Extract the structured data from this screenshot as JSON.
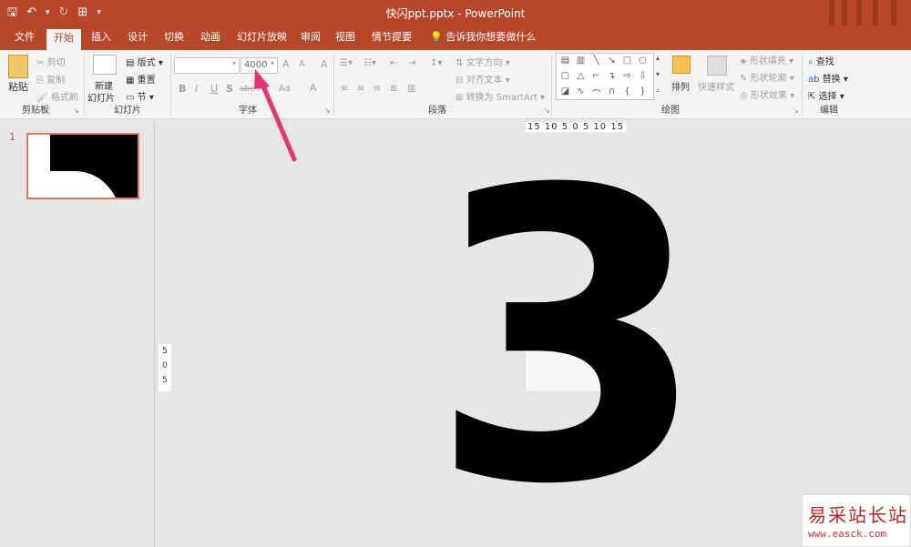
{
  "window": {
    "title": "快闪ppt.pptx  -  PowerPoint"
  },
  "qat": {
    "save": "🖫",
    "undo": "↶",
    "undo_drop": "▾",
    "redo": "↻",
    "present": "⊞",
    "customize": "▾"
  },
  "tabs": [
    "文件",
    "开始",
    "插入",
    "设计",
    "切换",
    "动画",
    "幻灯片放映",
    "审阅",
    "视图",
    "情节提要"
  ],
  "tell_me": "告诉我你想要做什么",
  "clipboard": {
    "paste": "粘贴",
    "cut": "剪切",
    "copy": "复制",
    "format_painter": "格式刷",
    "label": "剪贴板"
  },
  "slides": {
    "new_slide_line1": "新建",
    "new_slide_line2": "幻灯片",
    "layout": "版式",
    "reset": "重置",
    "section": "节",
    "label": "幻灯片"
  },
  "font": {
    "font_name": "",
    "font_size": "4000",
    "grow": "A",
    "shrink": "A",
    "clear": "A",
    "bold": "B",
    "italic": "I",
    "underline": "U",
    "shadow": "S",
    "strike": "abc",
    "spacing": "AV",
    "case": "Aa",
    "color": "A",
    "label": "字体"
  },
  "paragraph": {
    "text_direction": "文字方向",
    "align_text": "对齐文本",
    "smartart": "转换为 SmartArt",
    "label": "段落"
  },
  "drawing": {
    "arrange": "排列",
    "quick_styles": "快速样式",
    "shape_fill": "形状填充",
    "shape_outline": "形状轮廓",
    "shape_effects": "形状效果",
    "label": "绘图"
  },
  "editing": {
    "find": "查找",
    "replace": "替换",
    "select": "选择",
    "label": "编辑"
  },
  "thumbnails": [
    {
      "number": "1"
    }
  ],
  "canvas": {
    "ruler_h": "15 10 5  0  5 10 15",
    "ruler_v": [
      "5",
      "0",
      "5"
    ],
    "slide_text": "3"
  },
  "watermark": {
    "title": "易采站长站",
    "url": "www.easck.com"
  },
  "colors": {
    "accent": "#b7472a",
    "arrow": "#e8336d"
  }
}
